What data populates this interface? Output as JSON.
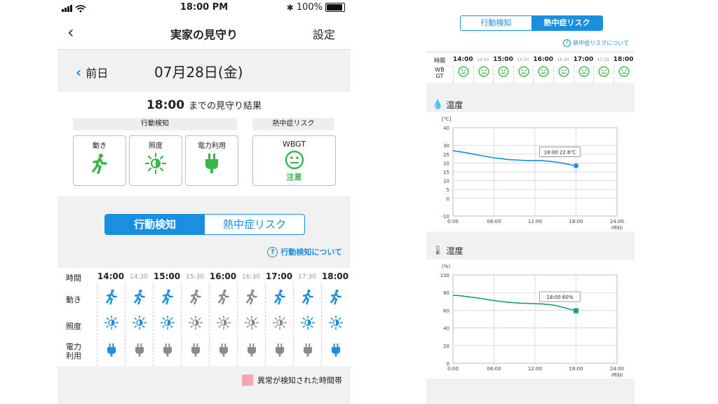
{
  "left": {
    "status": {
      "time": "18:00 PM",
      "battery": "100%",
      "battery_level": 1.0
    },
    "nav": {
      "back_icon": "chevron-left-icon",
      "title": "実家の見守り",
      "settings": "設定"
    },
    "date_bar": {
      "prev_label": "前日",
      "date": "07月28日(金)"
    },
    "result": {
      "time": "18:00",
      "text": "までの見守り結果"
    },
    "sections": {
      "activity": "行動検知",
      "heat": "熱中症リスク"
    },
    "cards": [
      {
        "label": "動き",
        "icon": "person-walking-icon"
      },
      {
        "label": "照度",
        "icon": "brightness-icon"
      },
      {
        "label": "電力利用",
        "icon": "plug-icon"
      }
    ],
    "wbgt_card": {
      "label": "WBGT",
      "icon": "neutral-face-icon",
      "status": "注意"
    },
    "tabs": [
      {
        "label": "行動検知",
        "active": true
      },
      {
        "label": "熱中症リスク",
        "active": false
      }
    ],
    "about_link": "行動検知について",
    "grid": {
      "row_labels": {
        "time": "時間",
        "movement": "動き",
        "light": "照度",
        "power": "電力\n利用"
      },
      "times": [
        "14:00",
        "14:30",
        "15:00",
        "15:30",
        "16:00",
        "16:30",
        "17:00",
        "17:30",
        "18:00"
      ],
      "movement": [
        "active",
        "active",
        "active",
        "inactive",
        "inactive",
        "inactive",
        "active",
        "active",
        "active"
      ],
      "light": [
        "active",
        "active",
        "active",
        "inactive",
        "inactive",
        "inactive",
        "inactive",
        "active",
        "active"
      ],
      "power": [
        "active",
        "inactive",
        "inactive",
        "inactive",
        "inactive",
        "inactive",
        "inactive",
        "inactive",
        "active"
      ]
    },
    "legend": "異常が検知された時間帯",
    "colors": {
      "accent": "#1a8fe0",
      "green": "#3cb54a",
      "inactive": "#8a8a8a",
      "alert": "#f6a6ae"
    }
  },
  "right": {
    "tabs": [
      {
        "label": "行動検知",
        "active": false
      },
      {
        "label": "熱中症リスク",
        "active": true
      }
    ],
    "about_link": "熱中症リスクについて",
    "grid": {
      "row_labels": {
        "time": "時間",
        "wbgt": "WB\nGT"
      },
      "times": [
        "14:00",
        "14:30",
        "15:00",
        "15:30",
        "16:00",
        "16:30",
        "17:00",
        "17:30",
        "18:00"
      ],
      "wbgt_icon": "neutral-face-icon"
    }
  },
  "chart_data": [
    {
      "type": "line",
      "title": "温度",
      "ylabel": "[℃]",
      "xlabel": "(時刻)",
      "x_ticks": [
        "0:00",
        "06:00",
        "12:00",
        "18:00",
        "24:00"
      ],
      "y_ticks": [
        -10,
        0,
        5,
        10,
        15,
        20,
        25,
        30,
        40
      ],
      "ylim": [
        -10,
        40
      ],
      "xlim": [
        0,
        24
      ],
      "x": [
        0,
        1,
        2,
        3,
        4,
        5,
        6,
        7,
        8,
        9,
        10,
        11,
        12,
        13,
        14,
        15,
        16,
        17,
        18
      ],
      "values": [
        27.0,
        26.4,
        25.8,
        25.0,
        24.3,
        23.6,
        22.9,
        22.5,
        22.0,
        21.8,
        21.5,
        21.4,
        21.4,
        21.3,
        21.0,
        20.6,
        19.9,
        19.2,
        18.4
      ],
      "annotation": {
        "label": "18:00 22.6℃",
        "x": 18
      },
      "color": "#1a8fe0",
      "grid": true
    },
    {
      "type": "line",
      "title": "湿度",
      "ylabel": "(%)",
      "xlabel": "(時刻)",
      "x_ticks": [
        "0:00",
        "06:00",
        "12:00",
        "18:00",
        "24:00"
      ],
      "y_ticks": [
        0,
        20,
        40,
        60,
        80,
        100
      ],
      "ylim": [
        0,
        100
      ],
      "xlim": [
        0,
        24
      ],
      "x": [
        0,
        1,
        2,
        3,
        4,
        5,
        6,
        7,
        8,
        9,
        10,
        11,
        12,
        13,
        14,
        15,
        16,
        17,
        18
      ],
      "values": [
        77,
        76.5,
        75.5,
        74.5,
        73.5,
        72.3,
        71,
        70,
        69.2,
        68.5,
        68,
        67.8,
        67.5,
        67.2,
        66.5,
        65.5,
        63.5,
        61.5,
        59.5
      ],
      "annotation": {
        "label": "18:00  60%",
        "x": 18
      },
      "color": "#13a07a",
      "grid": true
    }
  ]
}
